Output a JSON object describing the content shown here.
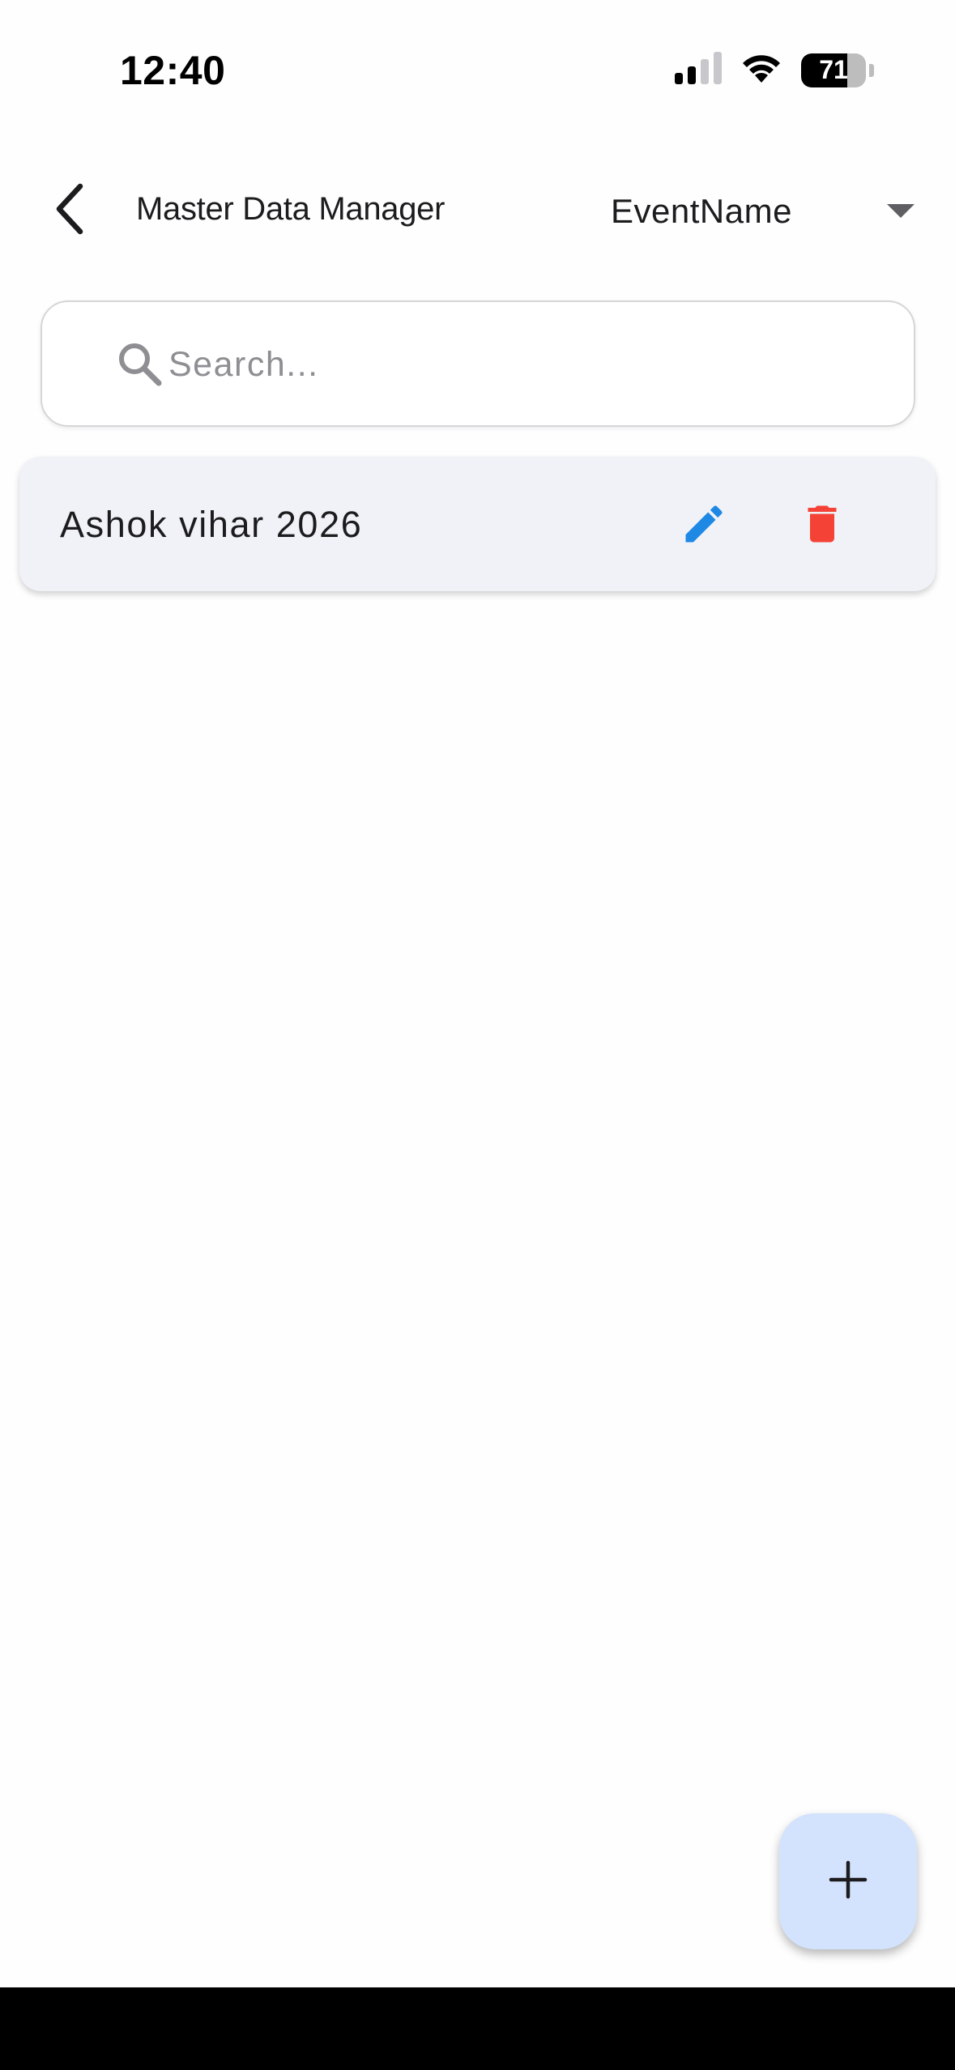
{
  "status_bar": {
    "time": "12:40",
    "battery_level": 71,
    "battery_text": "71",
    "signal_bars_active": 2,
    "signal_bars_total": 4
  },
  "app_bar": {
    "title": "Master Data Manager",
    "dropdown_value": "EventName"
  },
  "search": {
    "placeholder": "Search...",
    "value": ""
  },
  "items": [
    {
      "label": "Ashok vihar 2026"
    }
  ],
  "colors": {
    "edit_icon": "#1e88e5",
    "delete_icon": "#f44336",
    "fab_background": "#d3e3fd",
    "card_background": "#f0f2f7"
  },
  "icons": {
    "back": "chevron-left-icon",
    "dropdown": "caret-down-icon",
    "search": "search-icon",
    "edit": "pencil-icon",
    "delete": "trash-icon",
    "add": "plus-icon"
  }
}
